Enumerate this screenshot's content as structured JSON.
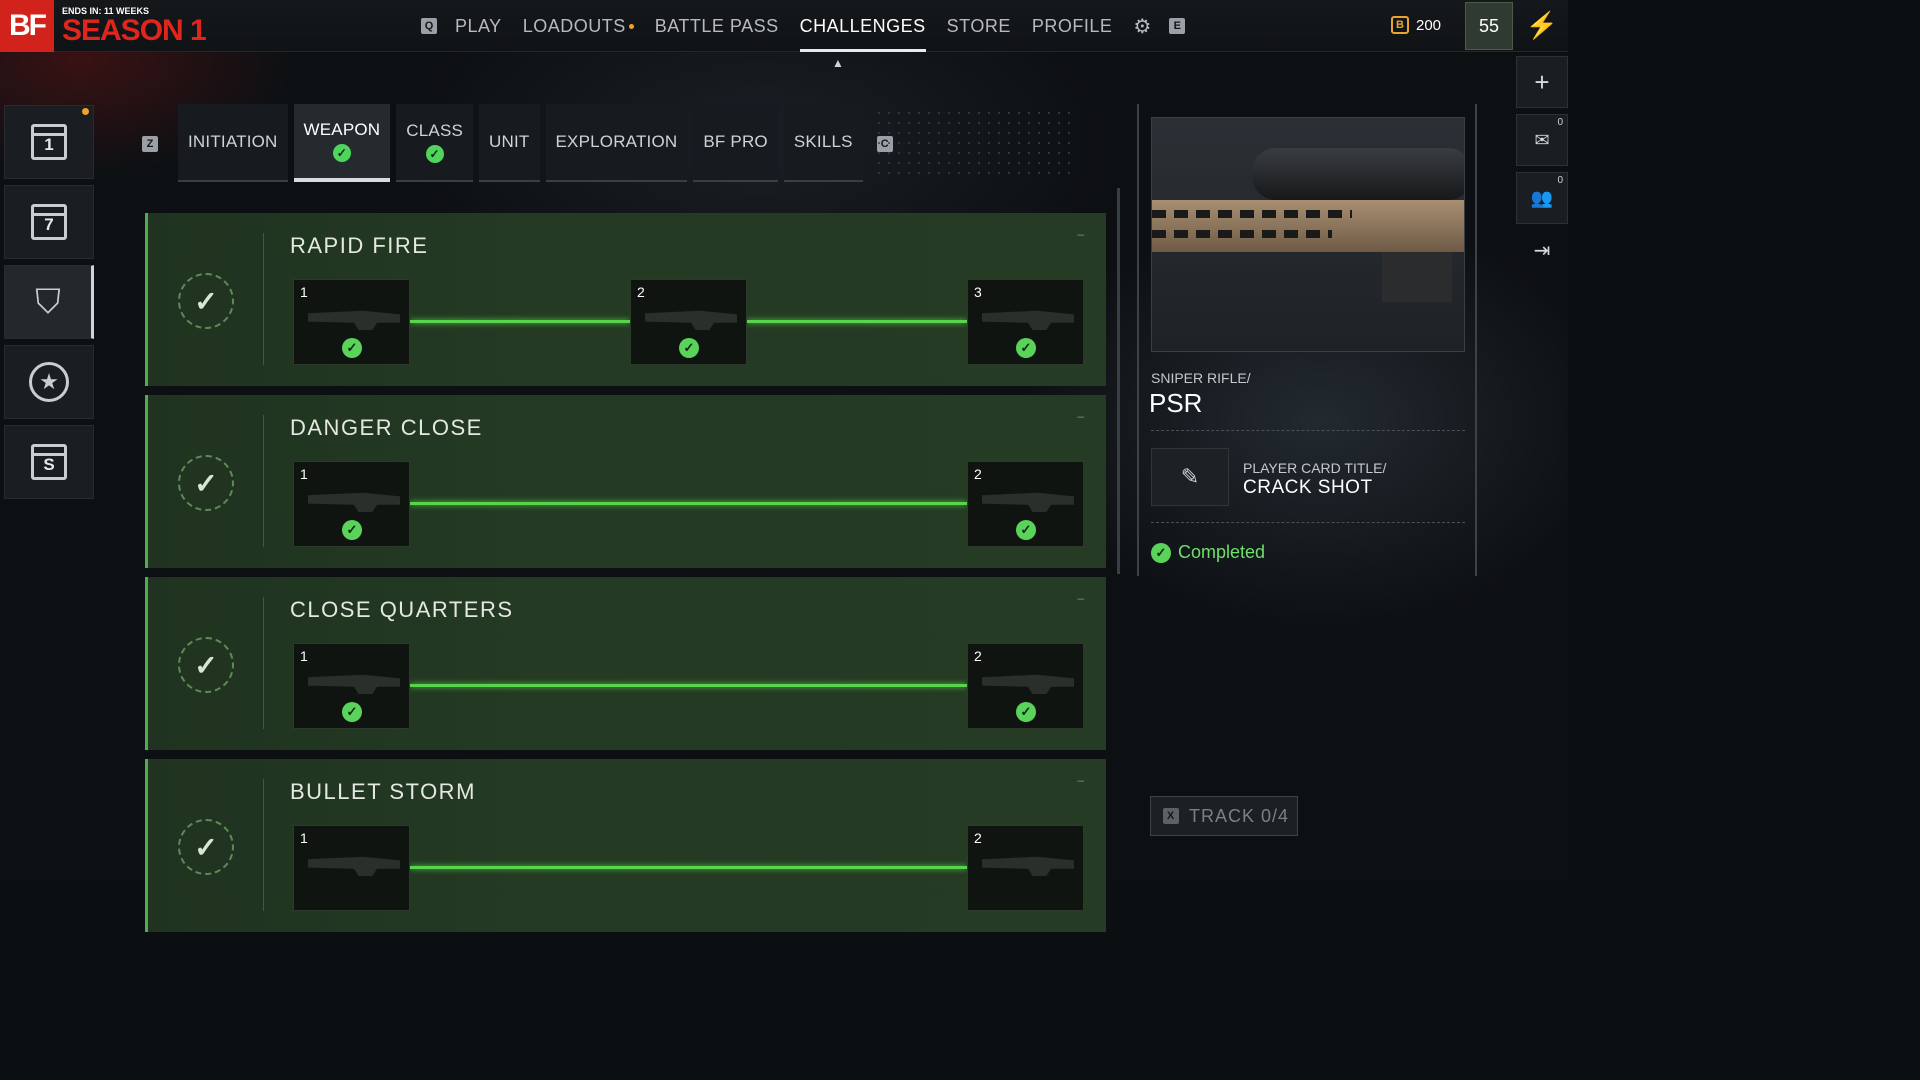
{
  "season": {
    "logo": "BF",
    "ends_in": "ENDS IN: 11 WEEKS",
    "title": "SEASON 1"
  },
  "nav": {
    "left_key": "Q",
    "items": [
      {
        "label": "PLAY"
      },
      {
        "label": "LOADOUTS"
      },
      {
        "label": "BATTLE PASS"
      },
      {
        "label": "CHALLENGES"
      },
      {
        "label": "STORE"
      },
      {
        "label": "PROFILE"
      }
    ],
    "active": "CHALLENGES",
    "right_key": "E"
  },
  "currency": {
    "icon": "B",
    "amount": "200"
  },
  "player_level": "55",
  "sidebar": {
    "items": [
      {
        "icon": "daily-calendar-icon",
        "label": "1"
      },
      {
        "icon": "weekly-calendar-icon",
        "label": "7"
      },
      {
        "icon": "shield-star-icon",
        "label": ""
      },
      {
        "icon": "star-circle-icon",
        "label": ""
      },
      {
        "icon": "season-calendar-icon",
        "label": "S"
      }
    ]
  },
  "category_tabs": {
    "left_key": "Z",
    "right_key": "C",
    "tabs": [
      {
        "label": "INITIATION",
        "completed": false
      },
      {
        "label": "WEAPON",
        "completed": true
      },
      {
        "label": "CLASS",
        "completed": true
      },
      {
        "label": "UNIT",
        "completed": false
      },
      {
        "label": "EXPLORATION",
        "completed": false
      },
      {
        "label": "BF PRO",
        "completed": false
      },
      {
        "label": "SKILLS",
        "completed": false
      }
    ],
    "active": "WEAPON"
  },
  "challenges": [
    {
      "title": "RAPID FIRE",
      "tiers": [
        "1",
        "2",
        "3"
      ],
      "completed": true
    },
    {
      "title": "DANGER CLOSE",
      "tiers": [
        "1",
        "2"
      ],
      "completed": true
    },
    {
      "title": "CLOSE QUARTERS",
      "tiers": [
        "1",
        "2"
      ],
      "completed": true
    },
    {
      "title": "BULLET STORM",
      "tiers": [
        "1",
        "2"
      ],
      "completed": true
    }
  ],
  "detail": {
    "weapon_type": "SNIPER RIFLE/",
    "weapon_name": "PSR",
    "reward_type": "PLAYER CARD TITLE/",
    "reward_name": "CRACK SHOT",
    "status": "Completed"
  },
  "track_button": {
    "key": "X",
    "label": "TRACK 0/4"
  },
  "right_rail": {
    "add_label": "+",
    "mail_count": "0",
    "squad_count": "0"
  },
  "colors": {
    "accent_green": "#5ad35b",
    "brand_red": "#d1221b",
    "currency_gold": "#e8a631"
  }
}
